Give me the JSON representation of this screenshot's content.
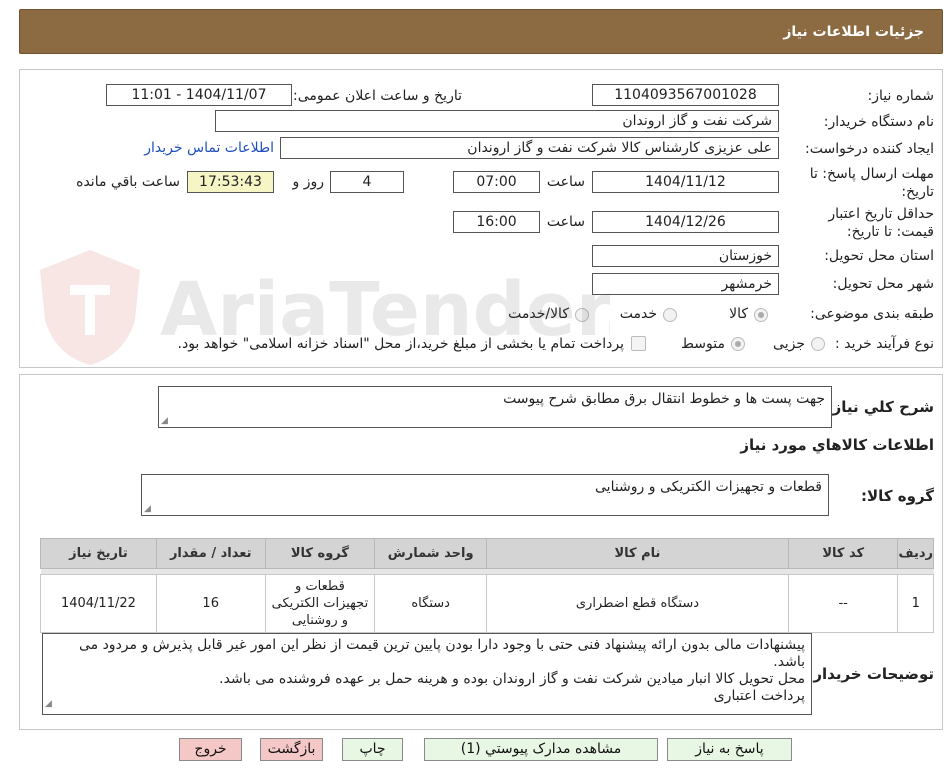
{
  "header": {
    "title": "جزئیات اطلاعات نیاز"
  },
  "form": {
    "need_number_label": "شماره نیاز:",
    "need_number": "1104093567001028",
    "announce_label": "تاریخ و ساعت اعلان عمومی:",
    "announce_value": "1404/11/07 - 11:01",
    "buyer_org_label": "نام دستگاه خریدار:",
    "buyer_org": "شرکت نفت و گاز اروندان",
    "requester_label": "ایجاد کننده درخواست:",
    "requester": "علی عزیزی کارشناس کالا شرکت نفت و گاز اروندان",
    "contact_link": "اطلاعات تماس خریدار",
    "deadline_label_1": "مهلت ارسال پاسخ: تا",
    "deadline_label_2": "تاریخ:",
    "deadline_date": "1404/11/12",
    "time_label": "ساعت",
    "deadline_time": "07:00",
    "days_value": "4",
    "days_label": "روز و",
    "remaining_time": "17:53:43",
    "remaining_label": "ساعت باقي مانده",
    "validity_label_1": "حداقل تاریخ اعتبار",
    "validity_label_2": "قیمت: تا تاریخ:",
    "validity_date": "1404/12/26",
    "validity_time": "16:00",
    "province_label": "استان محل تحویل:",
    "province": "خوزستان",
    "city_label": "شهر محل تحویل:",
    "city": "خرمشهر",
    "category_label": "طبقه بندی موضوعی:",
    "category_options": [
      "کالا",
      "خدمت",
      "کالا/خدمت"
    ],
    "process_label": "نوع فرآیند خرید :",
    "process_options": [
      "جزیی",
      "متوسط"
    ],
    "treasury_note": "پرداخت تمام یا بخشی از مبلغ خرید،از محل \"اسناد خزانه اسلامی\" خواهد بود."
  },
  "details": {
    "summary_label": "شرح کلي نياز:",
    "summary": "جهت پست ها و خطوط انتقال برق مطابق شرح پیوست",
    "goods_info_title": "اطلاعات کالاهاي مورد نياز",
    "goods_group_label": "گروه کالا:",
    "goods_group": "قطعات و تجهیزات الکتریکی و روشنایی",
    "table": {
      "headers": [
        "رديف",
        "کد کالا",
        "نام کالا",
        "واحد شمارش",
        "گروه کالا",
        "تعداد / مقدار",
        "تاريخ نياز"
      ],
      "rows": [
        [
          "1",
          "--",
          "دستگاه قطع اضطراری",
          "دستگاه",
          "قطعات و تجهیزات الکتریکی و روشنایی",
          "16",
          "1404/11/22"
        ]
      ]
    },
    "buyer_notes_label": "توضيحات خريدار:",
    "buyer_notes": [
      "پیشنهادات مالی بدون ارائه پیشنهاد فنی حتی با وجود دارا بودن پایین ترین قیمت از نظر این امور غیر قابل پذیرش و مردود می باشد.",
      "محل تحویل کالا انبار میادین شرکت نفت و گاز اروندان بوده و هرینه حمل بر عهده فروشنده می باشد.",
      "پرداخت اعتباری"
    ]
  },
  "buttons": {
    "reply": "پاسخ به نياز",
    "attachments": "مشاهده مدارک پيوستي (1)",
    "print": "چاپ",
    "back": "بازگشت",
    "exit": "خروج"
  },
  "watermark": {
    "text": "AriaTender.neT"
  },
  "colors": {
    "header_bg": "#8c6a42",
    "highlight": "#f5f5c6",
    "link": "#1f4fbf",
    "button_green": "#e8f6e4",
    "button_pink": "#f5c8c8"
  }
}
